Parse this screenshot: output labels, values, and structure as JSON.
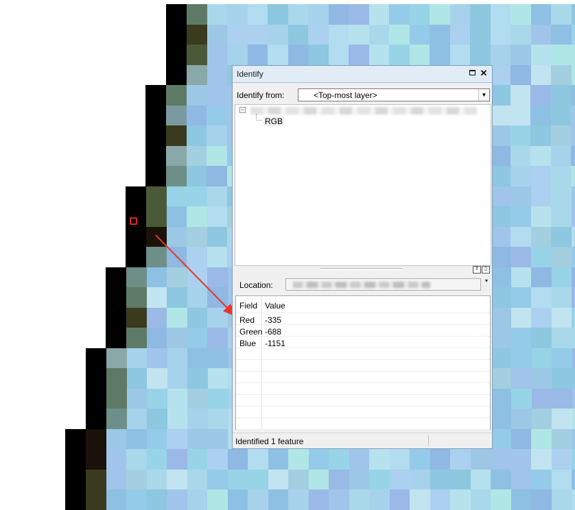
{
  "map": {
    "background": "#ffffff",
    "marker_color": "#e0261d",
    "arrow_color": "#e8352a"
  },
  "window": {
    "title": "Identify",
    "maximize_icon": "maximize-icon",
    "close_icon": "close-icon",
    "close_symbol": "✕"
  },
  "identify_from": {
    "label": "Identify from:",
    "selected": "<Top-most layer>",
    "dropdown_icon": "chevron-down-icon",
    "dropdown_symbol": "▼"
  },
  "tree": {
    "expander_symbol": "−",
    "child_label": "RGB"
  },
  "panel_buttons": [
    "⇑",
    "▯"
  ],
  "location": {
    "label": "Location:",
    "dropdown_symbol": "▾"
  },
  "results": {
    "headers": {
      "field": "Field",
      "value": "Value"
    },
    "rows": [
      {
        "field": "Red",
        "value": "-335"
      },
      {
        "field": "Green",
        "value": "-688"
      },
      {
        "field": "Blue",
        "value": "-1151"
      }
    ]
  },
  "status": {
    "text": "Identified 1 feature"
  }
}
